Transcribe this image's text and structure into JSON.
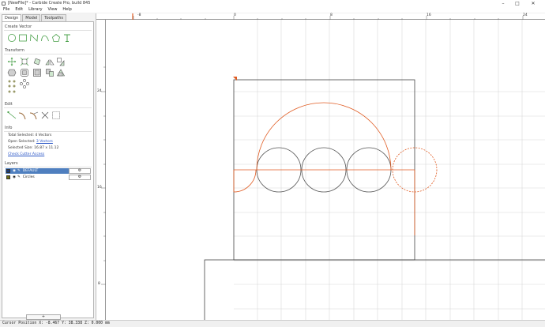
{
  "window": {
    "title": "[NewFile]* - Carbide Create Pro, build 845",
    "minimize": "–",
    "maximize": "□",
    "close": "✕"
  },
  "menu": [
    "File",
    "Edit",
    "Library",
    "View",
    "Help"
  ],
  "tabs": [
    "Design",
    "Model",
    "Toolpaths"
  ],
  "sections": {
    "create_vector": "Create Vector",
    "transform": "Transform",
    "edit": "Edit",
    "info": "Info",
    "layers": "Layers"
  },
  "info": {
    "total_selected": "Total Selected:  4 Vectors",
    "open_selected_label": "Open Selected:",
    "open_selected_value": "3 Vectors",
    "selected_size": "Selected Size:   16.87 x 11.12",
    "cutter_access": "Check Cutter Access"
  },
  "layers": [
    {
      "name": "DEFAULT",
      "color": "#1a3a7a",
      "selected": true,
      "gear": "⚙"
    },
    {
      "name": "Circles",
      "color": "#6b6b12",
      "selected": false,
      "gear": "⚙"
    }
  ],
  "add_layer": "+",
  "ruler": {
    "top": [
      "-8",
      "0",
      "8",
      "16",
      "24"
    ],
    "left": [
      "24",
      "16",
      "8"
    ]
  },
  "status": "Cursor Position X: -8.467 Y: 38.338 Z: 0.000 mm",
  "colors": {
    "selected_path": "#e05a20",
    "normal_path": "#555555",
    "grid": "#d8d8d8",
    "accent": "#4f7fbf"
  },
  "icons": {
    "create_vector": [
      "circle-icon",
      "rectangle-icon",
      "polyline-icon",
      "curve-icon",
      "polygon-icon",
      "text-icon"
    ],
    "transform": [
      "move-icon",
      "scale-icon",
      "rotate-icon",
      "mirror-icon",
      "align-icon",
      "offset-icon",
      "smooth-icon",
      "group-icon",
      "ungroup-icon",
      "boolean-icon",
      "array-icon",
      "pattern-icon",
      "circular-array-icon"
    ],
    "edit": [
      "node-edit-icon",
      "fillet-icon",
      "trim-icon",
      "cut-icon",
      "join-icon"
    ]
  }
}
